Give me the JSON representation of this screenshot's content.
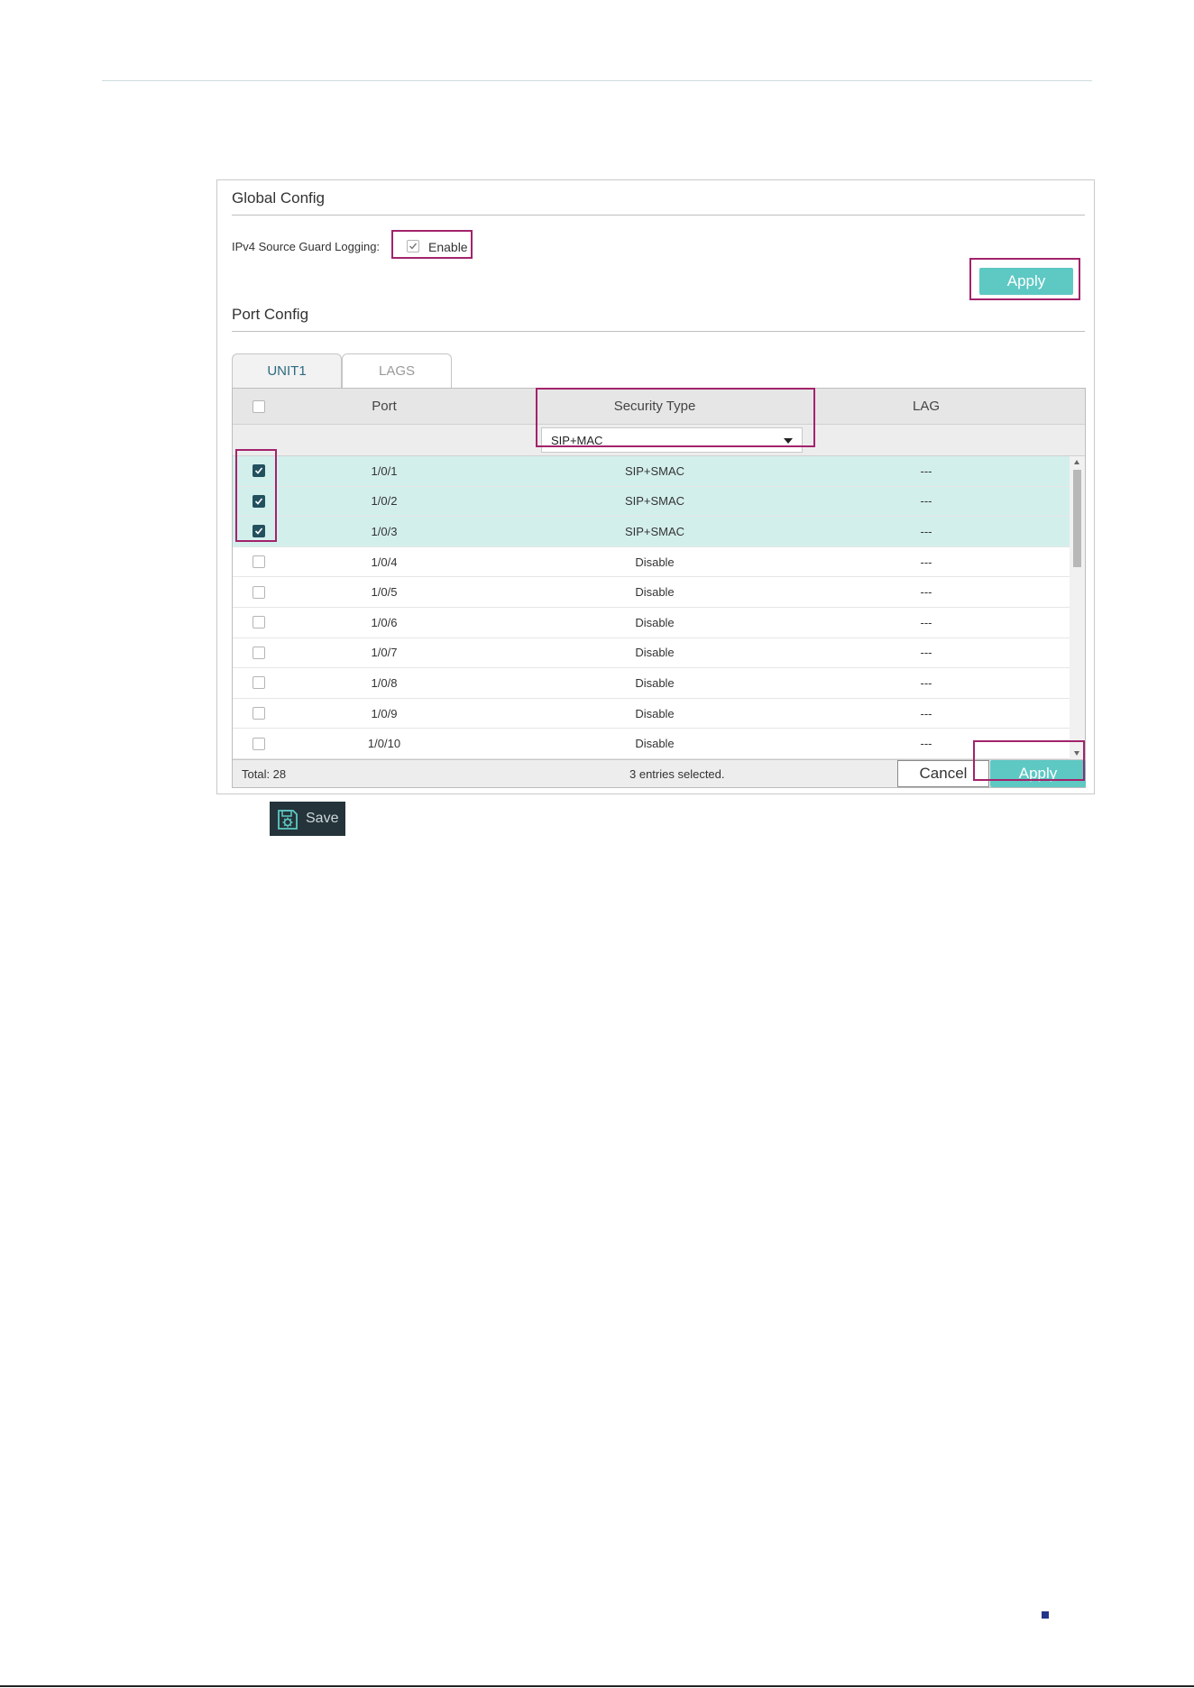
{
  "global_config": {
    "title": "Global Config",
    "logging_label": "IPv4 Source Guard Logging:",
    "enable_label": "Enable",
    "enable_checked": true,
    "apply_label": "Apply"
  },
  "port_config": {
    "title": "Port Config",
    "tabs": [
      {
        "label": "UNIT1",
        "active": true
      },
      {
        "label": "LAGS",
        "active": false
      }
    ],
    "columns": {
      "port": "Port",
      "security_type": "Security Type",
      "lag": "LAG"
    },
    "filter": {
      "security_type_value": "SIP+MAC"
    },
    "rows": [
      {
        "port": "1/0/1",
        "security_type": "SIP+SMAC",
        "lag": "---",
        "selected": true
      },
      {
        "port": "1/0/2",
        "security_type": "SIP+SMAC",
        "lag": "---",
        "selected": true
      },
      {
        "port": "1/0/3",
        "security_type": "SIP+SMAC",
        "lag": "---",
        "selected": true
      },
      {
        "port": "1/0/4",
        "security_type": "Disable",
        "lag": "---",
        "selected": false
      },
      {
        "port": "1/0/5",
        "security_type": "Disable",
        "lag": "---",
        "selected": false
      },
      {
        "port": "1/0/6",
        "security_type": "Disable",
        "lag": "---",
        "selected": false
      },
      {
        "port": "1/0/7",
        "security_type": "Disable",
        "lag": "---",
        "selected": false
      },
      {
        "port": "1/0/8",
        "security_type": "Disable",
        "lag": "---",
        "selected": false
      },
      {
        "port": "1/0/9",
        "security_type": "Disable",
        "lag": "---",
        "selected": false
      },
      {
        "port": "1/0/10",
        "security_type": "Disable",
        "lag": "---",
        "selected": false
      }
    ],
    "footer": {
      "total": "Total: 28",
      "selected": "3 entries selected.",
      "cancel_label": "Cancel",
      "apply_label": "Apply"
    }
  },
  "toolbar": {
    "save_label": "Save",
    "save_icon": "save-gear-icon"
  },
  "colors": {
    "accent": "#5ec8c3",
    "highlight": "#a3236b",
    "selected_row": "#d3efec",
    "checkbox_on": "#23505e"
  }
}
